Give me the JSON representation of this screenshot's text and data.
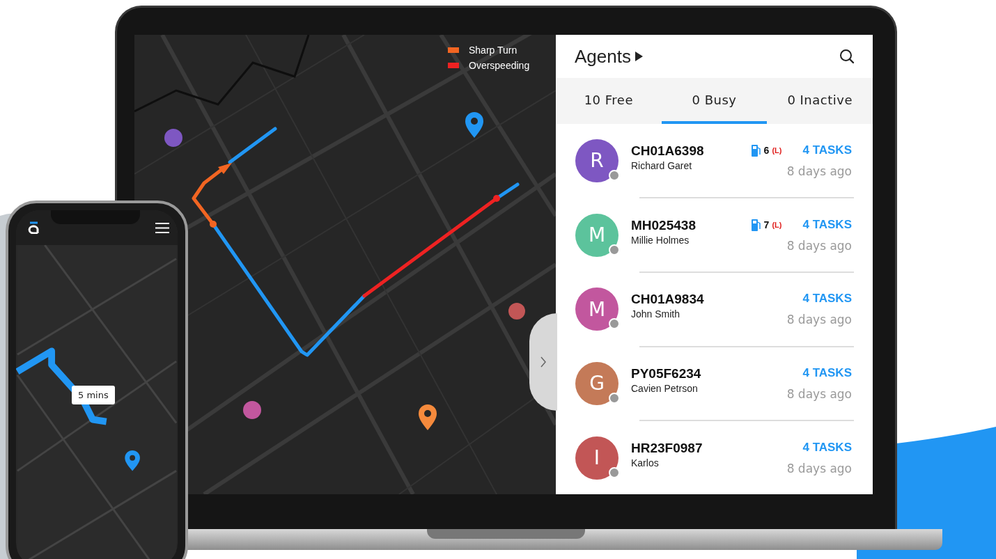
{
  "map": {
    "legend": [
      {
        "label": "Sharp Turn",
        "color": "#f26522"
      },
      {
        "label": "Overspeeding",
        "color": "#ee2222"
      }
    ]
  },
  "panel": {
    "title": "Agents",
    "tabs": [
      {
        "label": "10 Free",
        "selected": false
      },
      {
        "label": "0 Busy",
        "selected": true
      },
      {
        "label": "0 Inactive",
        "selected": false
      }
    ],
    "agents": [
      {
        "initial": "R",
        "color": "#7e57c2",
        "plate": "CH01A6398",
        "name": "Richard Garet",
        "fuel": "6",
        "fuel_flag": "(L)",
        "tasks": "4 TASKS",
        "time": "8 days ago"
      },
      {
        "initial": "M",
        "color": "#5cc39c",
        "plate": "MH025438",
        "name": "Millie Holmes",
        "fuel": "7",
        "fuel_flag": "(L)",
        "tasks": "4 TASKS",
        "time": "8 days ago"
      },
      {
        "initial": "M",
        "color": "#c2579e",
        "plate": "CH01A9834",
        "name": "John Smith",
        "tasks": "4 TASKS",
        "time": "8 days ago"
      },
      {
        "initial": "G",
        "color": "#c47a58",
        "plate": "PY05F6234",
        "name": "Cavien Petrson",
        "tasks": "4 TASKS",
        "time": "8 days ago"
      },
      {
        "initial": "I",
        "color": "#c25656",
        "plate": "HR23F0987",
        "name": "Karlos",
        "tasks": "4 TASKS",
        "time": "8 days ago"
      }
    ]
  },
  "phone": {
    "eta": "5 mins"
  }
}
